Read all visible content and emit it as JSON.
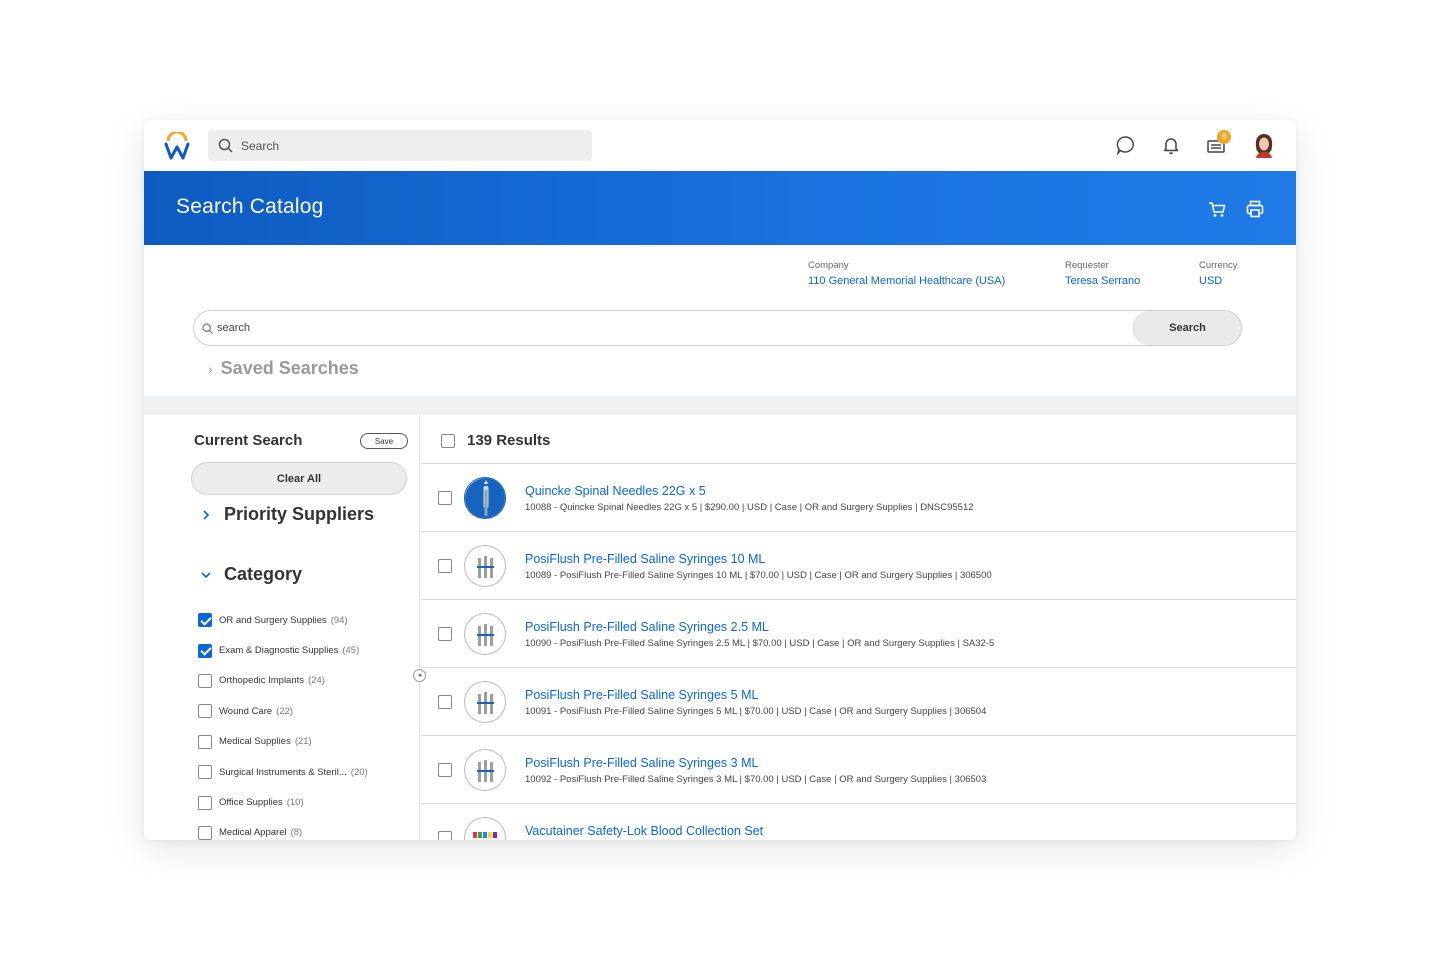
{
  "topbar": {
    "search_placeholder": "Search",
    "inbox_badge": "8",
    "icons": [
      "workday-logo-icon",
      "search-icon",
      "chat-icon",
      "bell-icon",
      "inbox-icon",
      "avatar"
    ]
  },
  "header": {
    "title": "Search Catalog",
    "icons": [
      "cart-icon",
      "print-icon"
    ]
  },
  "meta": {
    "company_label": "Company",
    "company_value": "110 General Memorial Healthcare (USA)",
    "requester_label": "Requester",
    "requester_value": "Teresa Serrano",
    "currency_label": "Currency",
    "currency_value": "USD"
  },
  "catalog_search": {
    "placeholder": "search",
    "button": "Search"
  },
  "saved_searches": "Saved Searches",
  "left": {
    "current_search": "Current Search",
    "save": "Save",
    "clear_all": "Clear All",
    "priority_suppliers": "Priority Suppliers",
    "category": "Category",
    "categories": [
      {
        "name": "OR and Surgery Supplies",
        "count": "(94)",
        "checked": true
      },
      {
        "name": "Exam & Diagnostic Supplies",
        "count": "(45)",
        "checked": true
      },
      {
        "name": "Orthopedic Implants",
        "count": "(24)",
        "checked": false
      },
      {
        "name": "Wound Care",
        "count": "(22)",
        "checked": false
      },
      {
        "name": "Medical Supplies",
        "count": "(21)",
        "checked": false
      },
      {
        "name": "Surgical Instruments & Steril...",
        "count": "(20)",
        "checked": false
      },
      {
        "name": "Office Supplies",
        "count": "(10)",
        "checked": false
      },
      {
        "name": "Medical Apparel",
        "count": "(8)",
        "checked": false
      }
    ]
  },
  "results": {
    "count_label": "139 Results",
    "items": [
      {
        "title": "Quincke Spinal Needles 22G x 5",
        "desc": "10088 - Quincke Spinal Needles 22G x 5 | $290.00 | USD | Case | OR and Surgery Supplies | DNSC95512",
        "thumb": "needle"
      },
      {
        "title": "PosiFlush Pre-Filled Saline Syringes 10 ML",
        "desc": "10089 - PosiFlush Pre-Filled Saline Syringes 10 ML | $70.00 | USD | Case | OR and Surgery Supplies | 306500",
        "thumb": "syringe"
      },
      {
        "title": "PosiFlush Pre-Filled Saline Syringes 2.5 ML",
        "desc": "10090 - PosiFlush Pre-Filled Saline Syringes 2.5 ML | $70.00 | USD | Case | OR and Surgery Supplies | SA32-5",
        "thumb": "syringe"
      },
      {
        "title": "PosiFlush Pre-Filled Saline Syringes 5 ML",
        "desc": "10091 - PosiFlush Pre-Filled Saline Syringes 5 ML | $70.00 | USD | Case | OR and Surgery Supplies | 306504",
        "thumb": "syringe"
      },
      {
        "title": "PosiFlush Pre-Filled Saline Syringes 3 ML",
        "desc": "10092 - PosiFlush Pre-Filled Saline Syringes 3 ML | $70.00 | USD | Case | OR and Surgery Supplies | 306503",
        "thumb": "syringe"
      },
      {
        "title": "Vacutainer Safety-Lok Blood Collection Set",
        "desc": "",
        "thumb": "tubes"
      }
    ]
  },
  "colors": {
    "header_blue": "#0e5bbf",
    "link_blue": "#0b66d6",
    "badge_orange": "#f5a623"
  }
}
